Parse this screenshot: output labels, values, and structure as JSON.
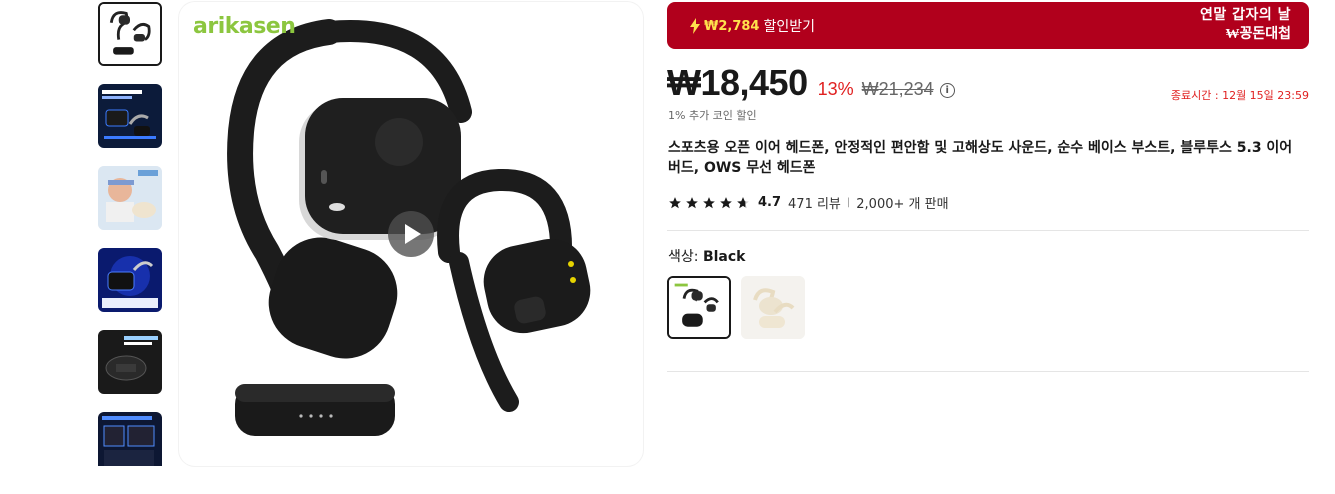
{
  "gallery": {
    "brand": "arikasen",
    "thumbnails": [
      {
        "name": "thumb-1",
        "selected": true
      },
      {
        "name": "thumb-2"
      },
      {
        "name": "thumb-3"
      },
      {
        "name": "thumb-4"
      },
      {
        "name": "thumb-5"
      },
      {
        "name": "thumb-6"
      }
    ],
    "play_icon": "play-icon"
  },
  "promo": {
    "amount": "₩2,784",
    "label": "할인받기",
    "right_line1": "연말 갑자의 날",
    "right_line2": "₩꽁돈대첩",
    "icon": "lightning-icon"
  },
  "price": {
    "current": "₩18,450",
    "discount": "13%",
    "original": "₩21,234",
    "info_icon": "i",
    "coin_note": "1% 추가 코인 할인",
    "countdown": "종료시간 : 12월 15일 23:59"
  },
  "product": {
    "title": "스포츠용 오픈 이어 헤드폰, 안정적인 편안함 및 고해상도 사운드, 순수 베이스 부스트, 블루투스 5.3 이어버드, OWS 무선 헤드폰",
    "rating": "4.7",
    "reviews": "471 리뷰",
    "separator": "|",
    "sold": "2,000+ 개 판매"
  },
  "color": {
    "label": "색상:",
    "selected": "Black",
    "options": [
      "Black",
      "Beige"
    ]
  },
  "colors": {
    "promo_bg": "#b1001c",
    "promo_amount": "#ffe14d",
    "discount": "#e02020",
    "brand": "#8cc63f"
  }
}
